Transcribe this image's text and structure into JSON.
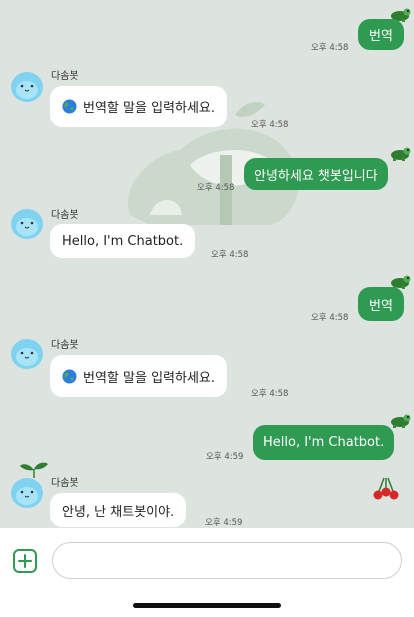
{
  "chat": {
    "messages": [
      {
        "type": "user",
        "text": "번역",
        "time": "오후 4:58"
      },
      {
        "type": "bot",
        "sender": "다솜봇",
        "text": "번역할 말을 입력하세요.",
        "time": "오후 4:58"
      },
      {
        "type": "user",
        "text": "안녕하세요 챗봇입니다",
        "time": "오후 4:58"
      },
      {
        "type": "bot",
        "sender": "다솜봇",
        "text": "Hello, I'm Chatbot.",
        "time": "오후 4:58"
      },
      {
        "type": "user",
        "text": "번역",
        "time": "오후 4:58"
      },
      {
        "type": "bot",
        "sender": "다솜봇",
        "text": "번역할 말을 입력하세요.",
        "time": "오후 4:58"
      },
      {
        "type": "user",
        "text": "Hello, I'm Chatbot.",
        "time": "오후 4:59"
      },
      {
        "type": "bot",
        "sender": "다솜봇",
        "text": "안녕, 난 채트봇이야.",
        "time": "오후 4:59"
      }
    ]
  },
  "input": {
    "value": "",
    "placeholder": ""
  },
  "icons": {
    "add": "plus-icon",
    "globe": "globe-icon",
    "avatar": "bot-avatar",
    "turtle": "turtle-icon"
  },
  "colors": {
    "user_bubble": "#2e9a52",
    "bot_bubble": "#ffffff",
    "chat_background": "#dde3de"
  }
}
